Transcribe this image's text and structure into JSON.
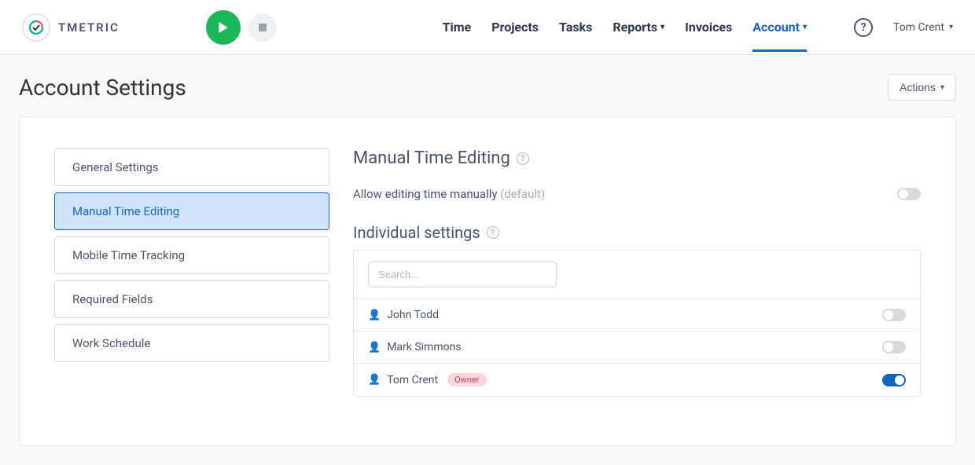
{
  "brand": {
    "name": "TMETRIC"
  },
  "nav": {
    "time": "Time",
    "projects": "Projects",
    "tasks": "Tasks",
    "reports": "Reports",
    "invoices": "Invoices",
    "account": "Account"
  },
  "user": {
    "name": "Tom Crent"
  },
  "page": {
    "title": "Account Settings",
    "actions_label": "Actions"
  },
  "sidetabs": {
    "general": "General Settings",
    "manual": "Manual Time Editing",
    "mobile": "Mobile Time Tracking",
    "required": "Required Fields",
    "schedule": "Work Schedule"
  },
  "section": {
    "title": "Manual Time Editing",
    "allow_label": "Allow editing time manually ",
    "allow_default": "(default)",
    "individual_title": "Individual settings",
    "search_placeholder": "Search...",
    "users": [
      {
        "name": "John Todd",
        "badge": "",
        "on": false
      },
      {
        "name": "Mark Simmons",
        "badge": "",
        "on": false
      },
      {
        "name": "Tom Crent",
        "badge": "Owner",
        "on": true
      }
    ]
  }
}
